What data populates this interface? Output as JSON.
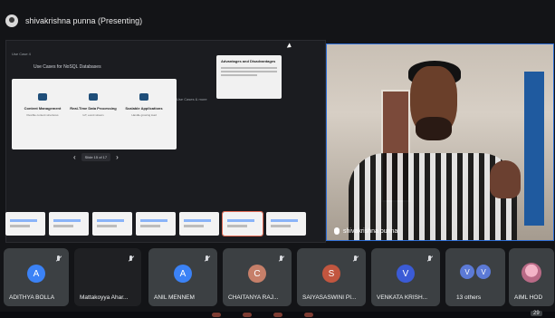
{
  "presenter": {
    "label": "shivakrishna punna (Presenting)"
  },
  "slide": {
    "title": "Use Cases for NoSQL Databases",
    "cards": [
      {
        "label": "Content Management",
        "sub": "Flexible content structures"
      },
      {
        "label": "Real-Time Data Processing",
        "sub": "IoT, event stream"
      },
      {
        "label": "Scalable Applications",
        "sub": "Handle growing load"
      }
    ],
    "note_title": "Advantages and Disadvantages",
    "mini_left": "Use Case 4",
    "mini_right": "Use Cases & more",
    "page_label": "Slide 15 of 17"
  },
  "video": {
    "name": "shivakrishna punna"
  },
  "participants": [
    {
      "initial": "A",
      "name": "ADITHYA BOLLA",
      "color": "#3b82f6"
    },
    {
      "initial": "",
      "name": "Mattakoyya Ahar...",
      "color": ""
    },
    {
      "initial": "A",
      "name": "ANIL MENNEM",
      "color": "#3b82f6"
    },
    {
      "initial": "C",
      "name": "CHAITANYA RAJ...",
      "color": "#c67f69"
    },
    {
      "initial": "S",
      "name": "SAIYASASWINI PI...",
      "color": "#c2563f"
    },
    {
      "initial": "V",
      "name": "VENKATA KRISH...",
      "color": "#3b5bd6"
    },
    {
      "initial": "",
      "name": "13 others",
      "color": "#5c7ad6"
    },
    {
      "initial": "",
      "name": "AIML HOD",
      "color": ""
    }
  ],
  "others_initials": [
    "V",
    "V"
  ],
  "bottom_badge": "29"
}
